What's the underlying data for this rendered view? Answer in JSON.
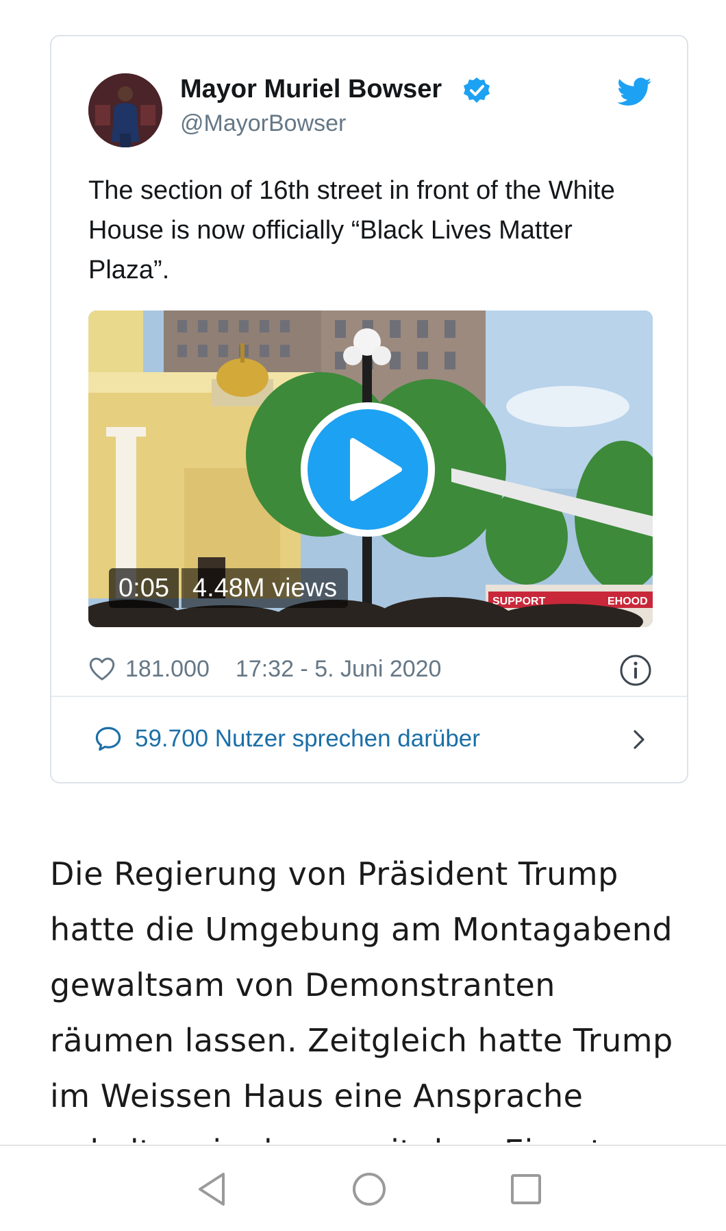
{
  "tweet": {
    "author_name": "Mayor Muriel Bowser",
    "handle": "@MayorBowser",
    "text": "The section of 16th street in front of the White House is now officially “Black Lives Matter Plaza”.",
    "media": {
      "duration": "0:05",
      "views": "4.48M views",
      "sign_text": "SUPPORT",
      "sign_text_right": "EHOOD"
    },
    "likes": "181.000",
    "timestamp": "17:32 - 5. Juni 2020",
    "conversation_label": "59.700 Nutzer sprechen darüber"
  },
  "article": {
    "lines": [
      "Die Regierung von Präsident Trump",
      "hatte die Umgebung am Montagabend",
      "gewaltsam von Demonstranten",
      "räumen lassen. Zeitgleich hatte Trump",
      "im Weissen Haus eine Ansprache",
      "gehalten, in der er mit dem Einsat"
    ]
  },
  "icons": {
    "verified": "verified-badge-icon",
    "brand": "twitter-bird-icon",
    "play": "play-icon",
    "like": "heart-icon",
    "info": "info-icon",
    "reply": "reply-bubble-icon",
    "chevron": "chevron-right-icon",
    "nav_back": "back-triangle-icon",
    "nav_home": "home-circle-icon",
    "nav_recents": "recents-square-icon"
  },
  "colors": {
    "twitter_blue": "#1da1f2",
    "link_blue": "#1b6fa8",
    "secondary_text": "#657786"
  }
}
